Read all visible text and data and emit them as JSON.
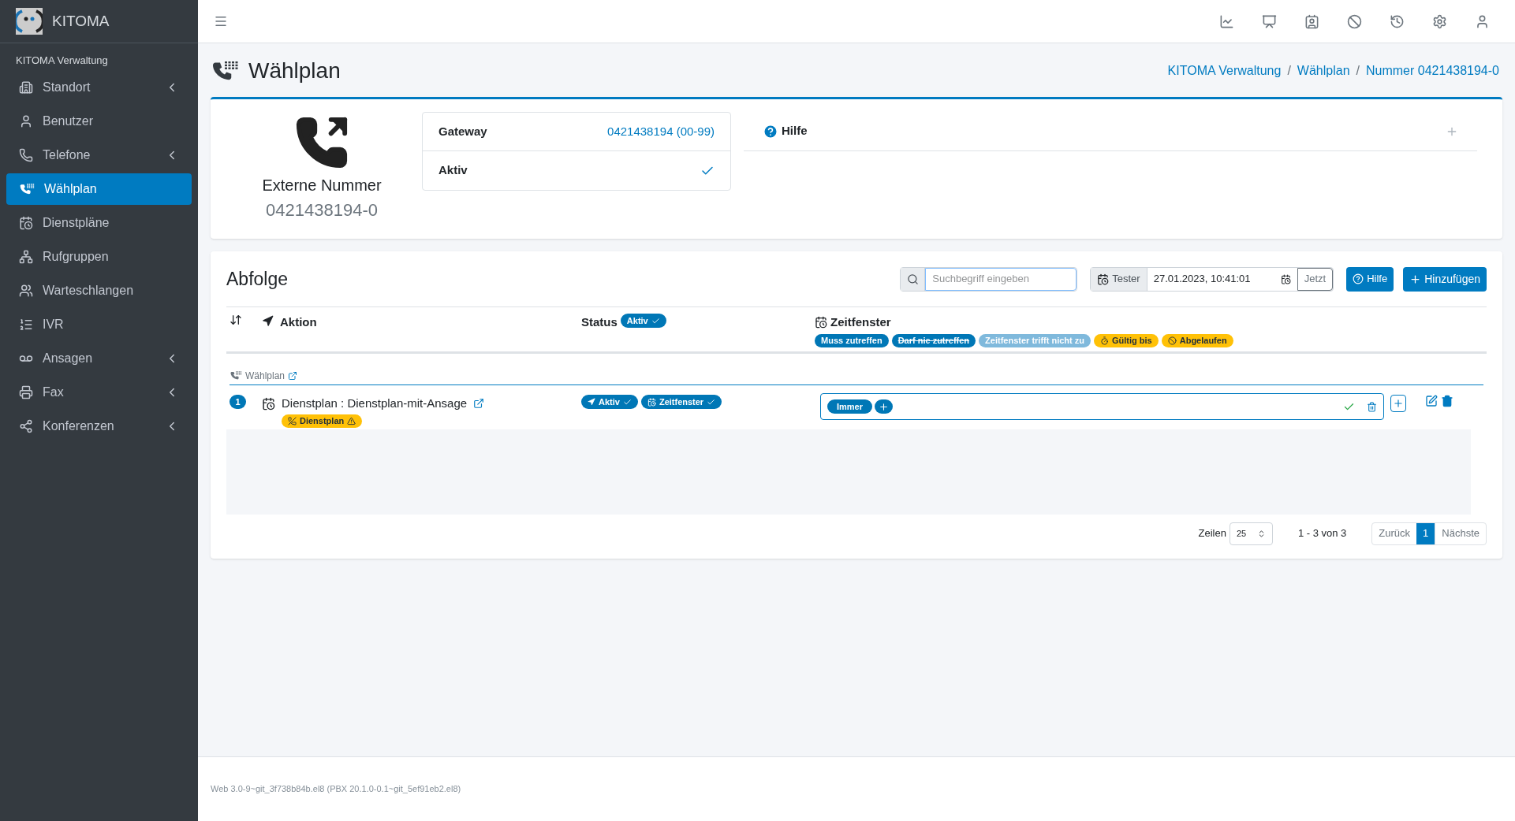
{
  "brand": {
    "name": "KITOMA"
  },
  "sidebar": {
    "section": "KITOMA Verwaltung",
    "items": [
      {
        "label": "Standort",
        "submenu": true,
        "selected": false
      },
      {
        "label": "Benutzer",
        "submenu": false,
        "selected": false
      },
      {
        "label": "Telefone",
        "submenu": true,
        "selected": false
      },
      {
        "label": "Wählplan",
        "submenu": false,
        "selected": true
      },
      {
        "label": "Dienstpläne",
        "submenu": false,
        "selected": false
      },
      {
        "label": "Rufgruppen",
        "submenu": false,
        "selected": false
      },
      {
        "label": "Warteschlangen",
        "submenu": false,
        "selected": false
      },
      {
        "label": "IVR",
        "submenu": false,
        "selected": false
      },
      {
        "label": "Ansagen",
        "submenu": true,
        "selected": false
      },
      {
        "label": "Fax",
        "submenu": true,
        "selected": false
      },
      {
        "label": "Konferenzen",
        "submenu": true,
        "selected": false
      }
    ]
  },
  "page": {
    "title": "Wählplan",
    "breadcrumb": [
      {
        "kind": "link",
        "text": "KITOMA Verwaltung"
      },
      {
        "kind": "separator",
        "text": "/"
      },
      {
        "kind": "link",
        "text": "Wählplan"
      },
      {
        "kind": "separator",
        "text": "/"
      },
      {
        "kind": "link",
        "text": "Nummer 0421438194-0"
      }
    ]
  },
  "summary": {
    "type_label": "Externe Nummer",
    "number": "0421438194-0",
    "gateway_label": "Gateway",
    "gateway_value": "0421438194 (00-99)",
    "active_label": "Aktiv",
    "active": true,
    "help_label": "Hilfe",
    "help_expanded": false
  },
  "sequence": {
    "title": "Abfolge",
    "search": {
      "placeholder": "Suchbegriff eingeben"
    },
    "tester_label": "Tester",
    "tester_value": "27.01.2023, 10:41:01",
    "now_button": "Jetzt",
    "help_button": "Hilfe",
    "add_button": "Hinzufügen",
    "columns": {
      "action": "Aktion",
      "status": "Status",
      "status_badge": "Aktiv",
      "timewindow": "Zeitfenster"
    },
    "legend": [
      {
        "label": "Muss zutreffen",
        "kind": "must"
      },
      {
        "label": "Darf nie zutreffen",
        "kind": "never"
      },
      {
        "label": "Zeitfenster trifft nicht zu",
        "kind": "miss"
      },
      {
        "label": "Gültig bis",
        "kind": "valid"
      },
      {
        "label": "Abgelaufen",
        "kind": "expired"
      }
    ],
    "group": "Wählplan",
    "rows": [
      {
        "index": "1",
        "action": "Dienstplan : Dienstplan-mit-Ansage",
        "warning": "Dienstplan",
        "status_badges": [
          "Aktiv",
          "Zeitfenster"
        ],
        "windows": [
          "Immer"
        ],
        "window_ok": true
      }
    ],
    "pagination": {
      "rows_label": "Zeilen",
      "page_size": "25",
      "range": "1 - 3 von 3",
      "prev": "Zurück",
      "pages": [
        {
          "label": "1",
          "selected": true
        }
      ],
      "next": "Nächste"
    }
  },
  "footer": "Web 3.0-9~git_3f738b84b.el8 (PBX 20.1.0-0.1~git_5ef91eb2.el8)"
}
